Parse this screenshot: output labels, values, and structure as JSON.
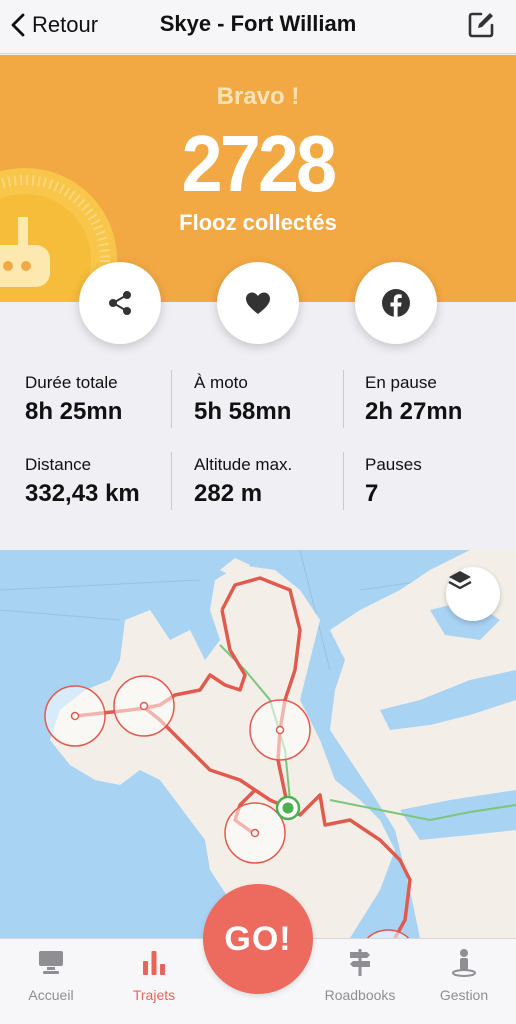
{
  "nav": {
    "back_label": "Retour",
    "title": "Skye - Fort William",
    "edit_icon": "edit-icon"
  },
  "hero": {
    "bravo": "Bravo !",
    "score": "2728",
    "score_label": "Flooz collectés",
    "background": "#f2a944"
  },
  "actions": [
    {
      "name": "share",
      "icon": "share-icon"
    },
    {
      "name": "favorite",
      "icon": "heart-icon"
    },
    {
      "name": "facebook",
      "icon": "facebook-icon"
    }
  ],
  "stats": [
    {
      "label": "Durée totale",
      "value": "8h 25mn"
    },
    {
      "label": "À moto",
      "value": "5h 58mn"
    },
    {
      "label": "En pause",
      "value": "2h 27mn"
    },
    {
      "label": "Distance",
      "value": "332,43 km"
    },
    {
      "label": "Altitude max.",
      "value": "282 m"
    },
    {
      "label": "Pauses",
      "value": "7"
    }
  ],
  "map": {
    "layers_icon": "layers-icon",
    "route_color": "#e05a4e",
    "water_color": "#a9d3f2",
    "land_color": "#f3efe8"
  },
  "go_button": {
    "label": "GO!",
    "color": "#ec6a5e"
  },
  "tabs": [
    {
      "label": "Accueil",
      "icon": "monitor-icon",
      "active": false
    },
    {
      "label": "Trajets",
      "icon": "bar-chart-icon",
      "active": true
    },
    {
      "label": "Roadbooks",
      "icon": "signpost-icon",
      "active": false
    },
    {
      "label": "Gestion",
      "icon": "person-icon",
      "active": false
    }
  ]
}
